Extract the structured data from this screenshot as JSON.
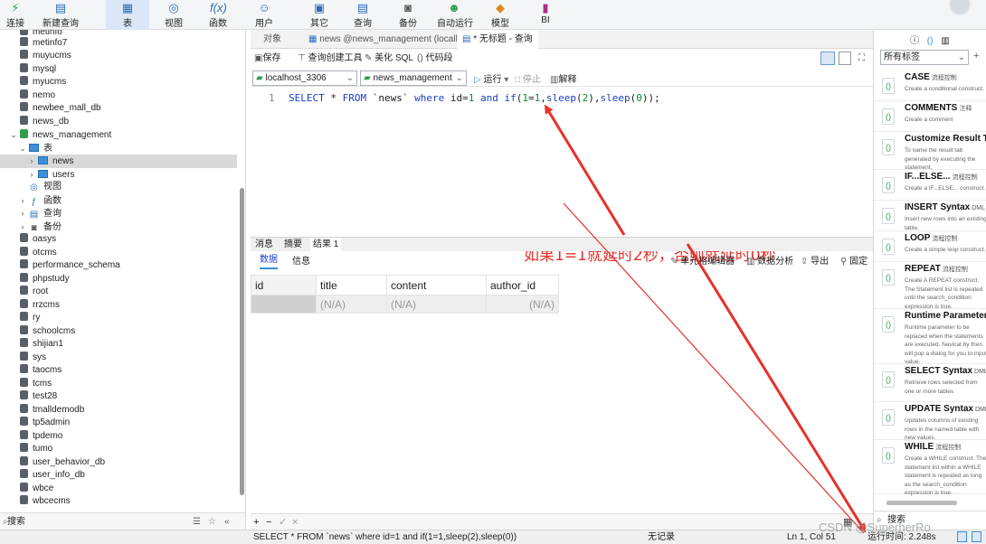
{
  "toolbar": {
    "items": [
      "连接",
      "新建查询",
      "表",
      "视图",
      "函数",
      "用户",
      "其它",
      "查询",
      "备份",
      "自动运行",
      "模型",
      "BI"
    ],
    "active": "表"
  },
  "sidebar": {
    "databases": [
      "metinfo",
      "metinfo7",
      "muyucms",
      "mysql",
      "myucms",
      "nemo",
      "newbee_mall_db",
      "news_db",
      "news_management"
    ],
    "tree": {
      "tables_label": "表",
      "tables": [
        "news",
        "users"
      ],
      "views": "视图",
      "functions": "函数",
      "queries": "查询",
      "backups": "备份"
    },
    "databases_after": [
      "oasys",
      "otcms",
      "performance_schema",
      "phpstudy",
      "root",
      "rrzcms",
      "ry",
      "schoolcms",
      "shijian1",
      "sys",
      "taocms",
      "tcms",
      "test28",
      "tmalldemodb",
      "tp5admin",
      "tpdemo",
      "tumo",
      "user_behavior_db",
      "user_info_db",
      "wbce",
      "wbcecms"
    ],
    "search": "搜索"
  },
  "tabs": [
    "对象",
    "news @news_management (localho...",
    "* 无标题 - 查询"
  ],
  "query_toolbar": {
    "save": "保存",
    "builder": "查询创建工具",
    "beautify": "美化 SQL",
    "snippet": "代码段"
  },
  "connection": {
    "server": "localhost_3306",
    "database": "news_management",
    "run": "运行",
    "stop": "停止",
    "explain": "解释"
  },
  "editor": {
    "line": "1",
    "sql": "SELECT * FROM `news` where id=1 and if(1=1,sleep(2),sleep(0));"
  },
  "annotation": "如果1=1就延时2秒，否则就延时0秒",
  "result_tabs": [
    "消息",
    "摘要",
    "结果 1"
  ],
  "data_bar": {
    "data": "数据",
    "info": "信息",
    "cell_editor": "单元格编辑器",
    "analysis": "数据分析",
    "export": "导出",
    "pin": "固定"
  },
  "grid": {
    "columns": [
      "id",
      "title",
      "content",
      "author_id"
    ],
    "row": [
      "",
      "(N/A)",
      "(N/A)",
      "(N/A)"
    ]
  },
  "right_panel": {
    "filter": "所有标签",
    "snippets": [
      {
        "title": "CASE",
        "tag": "流程控制",
        "desc": "Create a conditional construct."
      },
      {
        "title": "COMMENTS",
        "tag": "注释",
        "desc": "Create a comment"
      },
      {
        "title": "Customize Result Ta",
        "tag": "",
        "desc": "To name the result tab generated by executing the statement."
      },
      {
        "title": "IF...ELSE...",
        "tag": "流程控制",
        "desc": "Create a IF...ELSE... construct."
      },
      {
        "title": "INSERT Syntax",
        "tag": "DML",
        "desc": "Insert new rows into an existing table."
      },
      {
        "title": "LOOP",
        "tag": "流程控制",
        "desc": "Create a simple loop construct."
      },
      {
        "title": "REPEAT",
        "tag": "流程控制",
        "desc": "Create A REPEAT construct. The Statement list is repeated until the search_condition expression is true."
      },
      {
        "title": "Runtime Parameter",
        "tag": "",
        "desc": "Runtime parameter to be replaced when the statements are executed. Navicat by then will pop a dialog for you to input value."
      },
      {
        "title": "SELECT Syntax",
        "tag": "DML",
        "desc": "Retrieve rows selected from one or more tables"
      },
      {
        "title": "UPDATE Syntax",
        "tag": "DML",
        "desc": "Updates columns of existing rows in the named table with new values."
      },
      {
        "title": "WHILE",
        "tag": "流程控制",
        "desc": "Create a WHILE construct. The statement list within a WHILE statement is repeated as long as the search_condition expression is true."
      }
    ],
    "search": "搜索"
  },
  "statusbar": {
    "sql": "SELECT * FROM `news` where id=1 and if(1=1,sleep(2),sleep(0))",
    "records": "无记录",
    "position": "Ln 1, Col 51",
    "runtime": "运行时间: 2.248s"
  },
  "watermark": "CSDN @SuperherRo",
  "colors": {
    "accent": "#1a3fc4",
    "annotation": "#e8302a",
    "db_active": "#2f9e4c"
  }
}
